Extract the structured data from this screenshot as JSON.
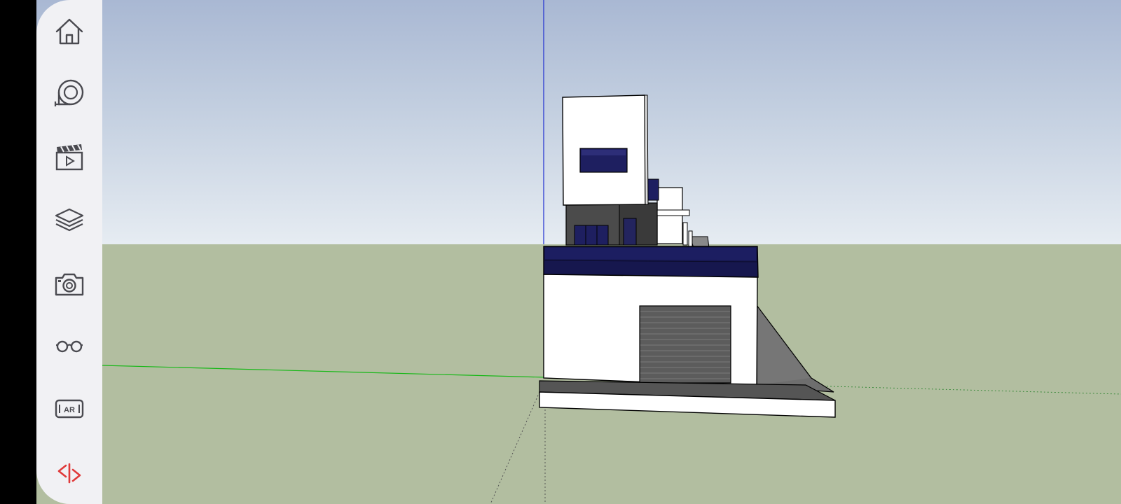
{
  "app": {
    "name": "SketchUp"
  },
  "toolbar": {
    "items": [
      {
        "name": "home",
        "icon": "home-icon"
      },
      {
        "name": "tape-measure",
        "icon": "tape-measure-icon"
      },
      {
        "name": "scenes",
        "icon": "clapperboard-icon"
      },
      {
        "name": "layers",
        "icon": "layers-icon"
      },
      {
        "name": "camera",
        "icon": "camera-icon"
      },
      {
        "name": "view",
        "icon": "glasses-icon"
      },
      {
        "name": "ar",
        "icon": "ar-icon",
        "label": "AR"
      },
      {
        "name": "sketchup-logo",
        "icon": "sketchup-logo-icon"
      }
    ]
  },
  "colors": {
    "sky_top": "#a9b8d3",
    "sky_bottom": "#e6ecf2",
    "ground": "#b2bea0",
    "sidebar": "#f1f1f4",
    "icon": "#4a4a50",
    "logo": "#e03a3a",
    "axis_blue": "#1f2fd0",
    "axis_green": "#18b818",
    "glass": "#1c1d5c"
  }
}
